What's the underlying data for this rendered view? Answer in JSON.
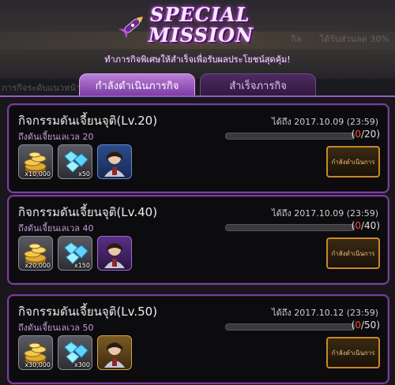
{
  "header": {
    "title_line1": "SPECIAL",
    "title_line2": "MISSION",
    "subtitle": "ทำภารกิจพิเศษให้สำเร็จเพื่อรับผลประโยชน์สุดคุ้ม!"
  },
  "background_fragments": {
    "frag_a": "กิล",
    "frag_b": "ได้รับส่วนลด 30%",
    "frag_c": "ภารกิจระดับแนวหน้า"
  },
  "tabs": [
    {
      "label": "กำลังดำเนินภารกิจ",
      "active": true
    },
    {
      "label": "สำเร็จภารกิจ",
      "active": false
    }
  ],
  "missions": [
    {
      "title": "กิจกรรมดันเจี้ยนจุติ(Lv.20)",
      "desc": "ถึงดันเจี้ยนเลเวล 20",
      "deadline": "ได้ถึง 2017.10.09 (23:59)",
      "progress_current": "0",
      "progress_total": "/20)",
      "progress_open": "(",
      "progress_fraction": 0,
      "rewards": [
        {
          "icon": "gold-coins-icon",
          "qty": "x10,000"
        },
        {
          "icon": "diamond-icon",
          "qty": "x50"
        },
        {
          "icon": "hero-portrait-icon",
          "qty": ""
        }
      ],
      "button": "กำลังดำเนินการ"
    },
    {
      "title": "กิจกรรมดันเจี้ยนจุติ(Lv.40)",
      "desc": "ถึงดันเจี้ยนเลเวล 40",
      "deadline": "ได้ถึง 2017.10.09 (23:59)",
      "progress_current": "0",
      "progress_total": "/40)",
      "progress_open": "(",
      "progress_fraction": 0,
      "rewards": [
        {
          "icon": "gold-coins-icon",
          "qty": "x20,000"
        },
        {
          "icon": "diamond-icon",
          "qty": "x150"
        },
        {
          "icon": "hero-portrait-icon",
          "qty": ""
        }
      ],
      "button": "กำลังดำเนินการ"
    },
    {
      "title": "กิจกรรมดันเจี้ยนจุติ(Lv.50)",
      "desc": "ถึงดันเจี้ยนเลเวล 50",
      "deadline": "ได้ถึง 2017.10.12 (23:59)",
      "progress_current": "0",
      "progress_total": "/50)",
      "progress_open": "(",
      "progress_fraction": 0,
      "rewards": [
        {
          "icon": "gold-coins-icon",
          "qty": "x30,000"
        },
        {
          "icon": "diamond-icon",
          "qty": "x300"
        },
        {
          "icon": "hero-portrait-icon",
          "qty": ""
        }
      ],
      "button": "กำลังดำเนินการ"
    }
  ],
  "colors": {
    "accent_purple": "#7a3e9e",
    "button_border": "#c9882a",
    "progress_current": "#ff4a3a"
  }
}
